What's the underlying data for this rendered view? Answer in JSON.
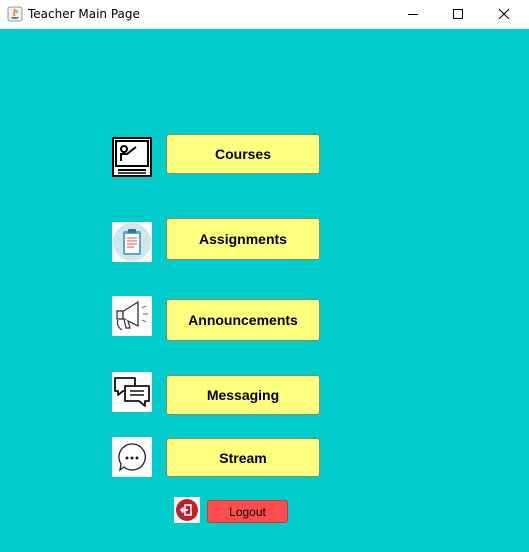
{
  "window": {
    "title": "Teacher Main Page",
    "controls": [
      "minimize",
      "maximize",
      "close"
    ]
  },
  "colors": {
    "background": "#00cccc",
    "menu_button": "#ffff80",
    "logout_button": "#ff4d4d"
  },
  "menu": [
    {
      "label": "Courses",
      "icon": "teacher-board-icon"
    },
    {
      "label": "Assignments",
      "icon": "clipboard-icon"
    },
    {
      "label": "Announcements",
      "icon": "megaphone-icon"
    },
    {
      "label": "Messaging",
      "icon": "chat-bubbles-icon"
    },
    {
      "label": "Stream",
      "icon": "speech-bubble-icon"
    }
  ],
  "logout": {
    "label": "Logout",
    "icon": "logout-icon"
  }
}
